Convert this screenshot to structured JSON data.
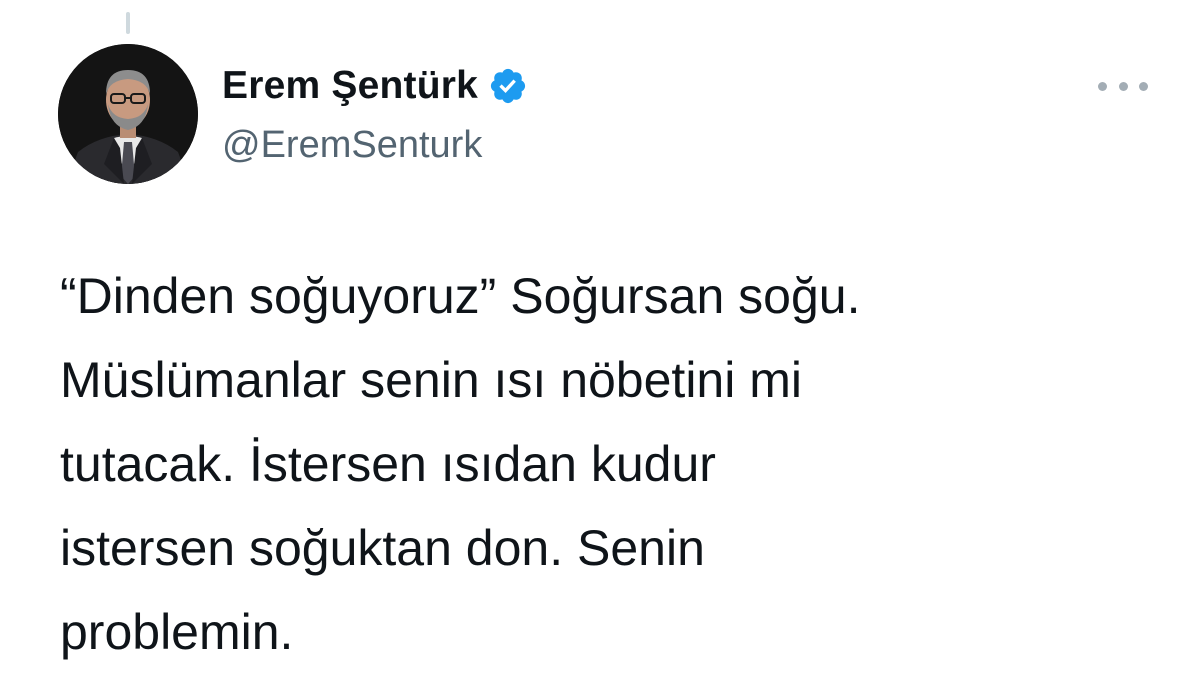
{
  "tweet": {
    "author": {
      "display_name": "Erem Şentürk",
      "handle": "@EremSenturk",
      "verified": true,
      "verified_color": "#1d9bf0"
    },
    "text_lines": [
      "“Dinden soğuyoruz” Soğursan soğu.",
      "Müslümanlar senin ısı nöbetini mi",
      "tutacak. İstersen ısıdan kudur",
      "istersen soğuktan don. Senin",
      "problemin."
    ],
    "more_icon": "more-horizontal-icon"
  }
}
